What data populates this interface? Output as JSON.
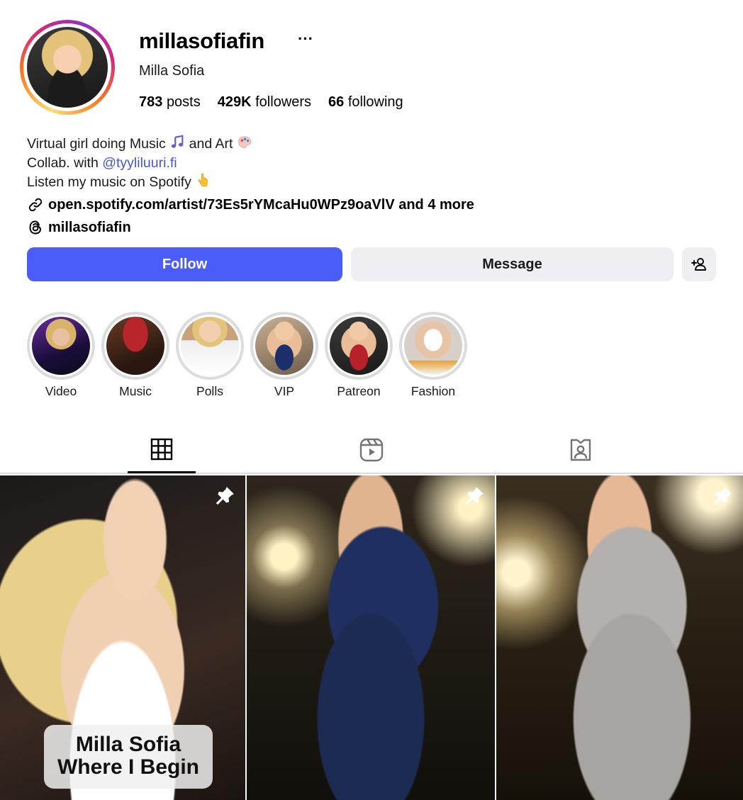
{
  "profile": {
    "username": "millasofiafin",
    "more_label": "···",
    "full_name": "Milla Sofia",
    "stats": {
      "posts_count": "783",
      "posts_label": "posts",
      "followers_count": "429K",
      "followers_label": "followers",
      "following_count": "66",
      "following_label": "following"
    },
    "bio": {
      "line1": "Virtual girl doing Music",
      "line1_and": "and Art",
      "line2_prefix": "Collab. with",
      "line2_mention": "@tyyliluuri.fi",
      "line3": "Listen my music on Spotify"
    },
    "link": "open.spotify.com/artist/73Es5rYMcaHu0WPz9oaVlV and 4 more",
    "threads_handle": "millasofiafin"
  },
  "buttons": {
    "follow": "Follow",
    "message": "Message"
  },
  "highlights": [
    {
      "label": "Video"
    },
    {
      "label": "Music"
    },
    {
      "label": "Polls"
    },
    {
      "label": "VIP"
    },
    {
      "label": "Patreon"
    },
    {
      "label": "Fashion"
    }
  ],
  "tabs": [
    {
      "name": "posts-grid-icon",
      "active": true
    },
    {
      "name": "reels-icon",
      "active": false
    },
    {
      "name": "tagged-icon",
      "active": false
    }
  ],
  "posts": [
    {
      "caption_line1": "Milla Sofia",
      "caption_line2": "Where I Begin",
      "pinned": true
    },
    {
      "pinned": true
    },
    {
      "pinned": true
    }
  ],
  "colors": {
    "follow_button": "#4a5df9",
    "secondary_button": "#efeff3",
    "mention": "#4355d6"
  }
}
